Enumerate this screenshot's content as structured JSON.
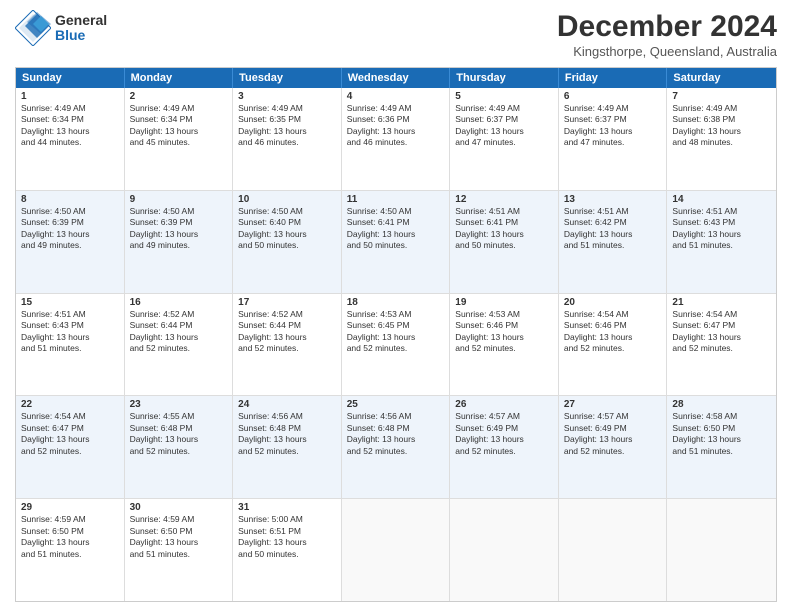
{
  "logo": {
    "general": "General",
    "blue": "Blue"
  },
  "title": "December 2024",
  "location": "Kingsthorpe, Queensland, Australia",
  "headers": [
    "Sunday",
    "Monday",
    "Tuesday",
    "Wednesday",
    "Thursday",
    "Friday",
    "Saturday"
  ],
  "rows": [
    [
      {
        "day": "1",
        "lines": [
          "Sunrise: 4:49 AM",
          "Sunset: 6:34 PM",
          "Daylight: 13 hours",
          "and 44 minutes."
        ]
      },
      {
        "day": "2",
        "lines": [
          "Sunrise: 4:49 AM",
          "Sunset: 6:34 PM",
          "Daylight: 13 hours",
          "and 45 minutes."
        ]
      },
      {
        "day": "3",
        "lines": [
          "Sunrise: 4:49 AM",
          "Sunset: 6:35 PM",
          "Daylight: 13 hours",
          "and 46 minutes."
        ]
      },
      {
        "day": "4",
        "lines": [
          "Sunrise: 4:49 AM",
          "Sunset: 6:36 PM",
          "Daylight: 13 hours",
          "and 46 minutes."
        ]
      },
      {
        "day": "5",
        "lines": [
          "Sunrise: 4:49 AM",
          "Sunset: 6:37 PM",
          "Daylight: 13 hours",
          "and 47 minutes."
        ]
      },
      {
        "day": "6",
        "lines": [
          "Sunrise: 4:49 AM",
          "Sunset: 6:37 PM",
          "Daylight: 13 hours",
          "and 47 minutes."
        ]
      },
      {
        "day": "7",
        "lines": [
          "Sunrise: 4:49 AM",
          "Sunset: 6:38 PM",
          "Daylight: 13 hours",
          "and 48 minutes."
        ]
      }
    ],
    [
      {
        "day": "8",
        "lines": [
          "Sunrise: 4:50 AM",
          "Sunset: 6:39 PM",
          "Daylight: 13 hours",
          "and 49 minutes."
        ]
      },
      {
        "day": "9",
        "lines": [
          "Sunrise: 4:50 AM",
          "Sunset: 6:39 PM",
          "Daylight: 13 hours",
          "and 49 minutes."
        ]
      },
      {
        "day": "10",
        "lines": [
          "Sunrise: 4:50 AM",
          "Sunset: 6:40 PM",
          "Daylight: 13 hours",
          "and 50 minutes."
        ]
      },
      {
        "day": "11",
        "lines": [
          "Sunrise: 4:50 AM",
          "Sunset: 6:41 PM",
          "Daylight: 13 hours",
          "and 50 minutes."
        ]
      },
      {
        "day": "12",
        "lines": [
          "Sunrise: 4:51 AM",
          "Sunset: 6:41 PM",
          "Daylight: 13 hours",
          "and 50 minutes."
        ]
      },
      {
        "day": "13",
        "lines": [
          "Sunrise: 4:51 AM",
          "Sunset: 6:42 PM",
          "Daylight: 13 hours",
          "and 51 minutes."
        ]
      },
      {
        "day": "14",
        "lines": [
          "Sunrise: 4:51 AM",
          "Sunset: 6:43 PM",
          "Daylight: 13 hours",
          "and 51 minutes."
        ]
      }
    ],
    [
      {
        "day": "15",
        "lines": [
          "Sunrise: 4:51 AM",
          "Sunset: 6:43 PM",
          "Daylight: 13 hours",
          "and 51 minutes."
        ]
      },
      {
        "day": "16",
        "lines": [
          "Sunrise: 4:52 AM",
          "Sunset: 6:44 PM",
          "Daylight: 13 hours",
          "and 52 minutes."
        ]
      },
      {
        "day": "17",
        "lines": [
          "Sunrise: 4:52 AM",
          "Sunset: 6:44 PM",
          "Daylight: 13 hours",
          "and 52 minutes."
        ]
      },
      {
        "day": "18",
        "lines": [
          "Sunrise: 4:53 AM",
          "Sunset: 6:45 PM",
          "Daylight: 13 hours",
          "and 52 minutes."
        ]
      },
      {
        "day": "19",
        "lines": [
          "Sunrise: 4:53 AM",
          "Sunset: 6:46 PM",
          "Daylight: 13 hours",
          "and 52 minutes."
        ]
      },
      {
        "day": "20",
        "lines": [
          "Sunrise: 4:54 AM",
          "Sunset: 6:46 PM",
          "Daylight: 13 hours",
          "and 52 minutes."
        ]
      },
      {
        "day": "21",
        "lines": [
          "Sunrise: 4:54 AM",
          "Sunset: 6:47 PM",
          "Daylight: 13 hours",
          "and 52 minutes."
        ]
      }
    ],
    [
      {
        "day": "22",
        "lines": [
          "Sunrise: 4:54 AM",
          "Sunset: 6:47 PM",
          "Daylight: 13 hours",
          "and 52 minutes."
        ]
      },
      {
        "day": "23",
        "lines": [
          "Sunrise: 4:55 AM",
          "Sunset: 6:48 PM",
          "Daylight: 13 hours",
          "and 52 minutes."
        ]
      },
      {
        "day": "24",
        "lines": [
          "Sunrise: 4:56 AM",
          "Sunset: 6:48 PM",
          "Daylight: 13 hours",
          "and 52 minutes."
        ]
      },
      {
        "day": "25",
        "lines": [
          "Sunrise: 4:56 AM",
          "Sunset: 6:48 PM",
          "Daylight: 13 hours",
          "and 52 minutes."
        ]
      },
      {
        "day": "26",
        "lines": [
          "Sunrise: 4:57 AM",
          "Sunset: 6:49 PM",
          "Daylight: 13 hours",
          "and 52 minutes."
        ]
      },
      {
        "day": "27",
        "lines": [
          "Sunrise: 4:57 AM",
          "Sunset: 6:49 PM",
          "Daylight: 13 hours",
          "and 52 minutes."
        ]
      },
      {
        "day": "28",
        "lines": [
          "Sunrise: 4:58 AM",
          "Sunset: 6:50 PM",
          "Daylight: 13 hours",
          "and 51 minutes."
        ]
      }
    ],
    [
      {
        "day": "29",
        "lines": [
          "Sunrise: 4:59 AM",
          "Sunset: 6:50 PM",
          "Daylight: 13 hours",
          "and 51 minutes."
        ]
      },
      {
        "day": "30",
        "lines": [
          "Sunrise: 4:59 AM",
          "Sunset: 6:50 PM",
          "Daylight: 13 hours",
          "and 51 minutes."
        ]
      },
      {
        "day": "31",
        "lines": [
          "Sunrise: 5:00 AM",
          "Sunset: 6:51 PM",
          "Daylight: 13 hours",
          "and 50 minutes."
        ]
      },
      {
        "day": "",
        "lines": []
      },
      {
        "day": "",
        "lines": []
      },
      {
        "day": "",
        "lines": []
      },
      {
        "day": "",
        "lines": []
      }
    ]
  ],
  "row_alt": [
    false,
    true,
    false,
    true,
    false
  ]
}
